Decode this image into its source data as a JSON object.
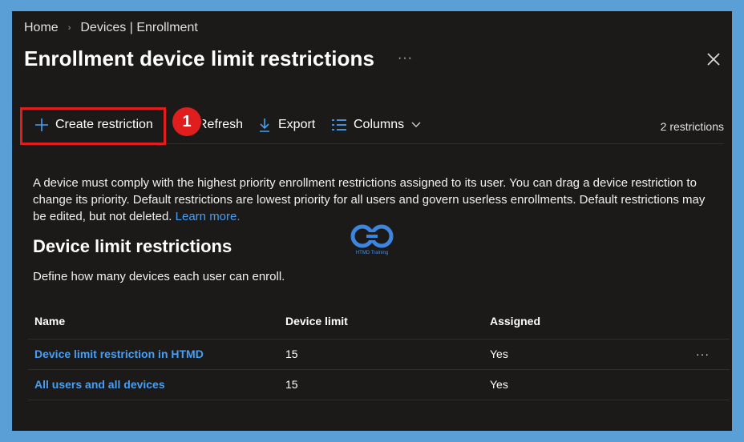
{
  "breadcrumb": {
    "home": "Home",
    "current": "Devices | Enrollment"
  },
  "header": {
    "title": "Enrollment device limit restrictions",
    "more_label": "···"
  },
  "toolbar": {
    "create_label": "Create restriction",
    "refresh_label": "Refresh",
    "export_label": "Export",
    "columns_label": "Columns",
    "count_label": "2 restrictions",
    "annotation_badge": "1"
  },
  "description": {
    "text": "A device must comply with the highest priority enrollment restrictions assigned to its user. You can drag a device restriction to change its priority. Default restrictions are lowest priority for all users and govern userless enrollments. Default restrictions may be edited, but not deleted.",
    "link": "Learn more."
  },
  "watermark": {
    "text": "HTMD Training"
  },
  "section": {
    "title": "Device limit restrictions",
    "subtitle": "Define how many devices each user can enroll."
  },
  "table": {
    "columns": [
      "Name",
      "Device limit",
      "Assigned"
    ],
    "rows": [
      {
        "name": "Device limit restriction in HTMD",
        "limit": "15",
        "assigned": "Yes",
        "more": "···"
      },
      {
        "name": "All users and all devices",
        "limit": "15",
        "assigned": "Yes"
      }
    ]
  },
  "colors": {
    "background": "#1b1a19",
    "frame": "#5aa0d6",
    "accent": "#479ef5",
    "highlight": "#e01e1e"
  }
}
